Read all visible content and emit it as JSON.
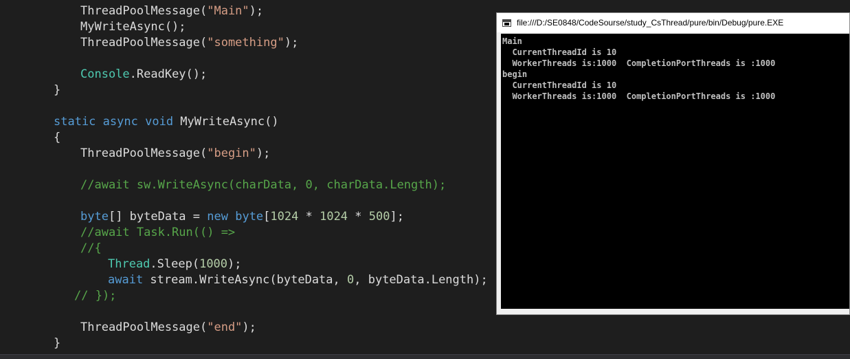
{
  "code_lines": [
    [
      {
        "t": "ThreadPoolMessage(",
        "c": "default"
      },
      {
        "t": "\"Main\"",
        "c": "string"
      },
      {
        "t": ");",
        "c": "default"
      }
    ],
    [
      {
        "t": "MyWriteAsync();",
        "c": "default"
      }
    ],
    [
      {
        "t": "ThreadPoolMessage(",
        "c": "default"
      },
      {
        "t": "\"something\"",
        "c": "string"
      },
      {
        "t": ");",
        "c": "default"
      }
    ],
    [],
    [
      {
        "t": "Console",
        "c": "type"
      },
      {
        "t": ".ReadKey();",
        "c": "default"
      }
    ],
    [
      {
        "t": "}",
        "c": "default"
      }
    ],
    [],
    [
      {
        "t": "static",
        "c": "keyword"
      },
      {
        "t": " ",
        "c": "default"
      },
      {
        "t": "async",
        "c": "keyword"
      },
      {
        "t": " ",
        "c": "default"
      },
      {
        "t": "void",
        "c": "keyword"
      },
      {
        "t": " MyWriteAsync()",
        "c": "default"
      }
    ],
    [
      {
        "t": "{",
        "c": "default"
      }
    ],
    [
      {
        "t": "ThreadPoolMessage(",
        "c": "default"
      },
      {
        "t": "\"begin\"",
        "c": "string"
      },
      {
        "t": ");",
        "c": "default"
      }
    ],
    [],
    [
      {
        "t": "//await sw.WriteAsync(charData, 0, charData.Length);",
        "c": "comment"
      }
    ],
    [],
    [
      {
        "t": "byte",
        "c": "keyword"
      },
      {
        "t": "[] byteData = ",
        "c": "default"
      },
      {
        "t": "new",
        "c": "keyword"
      },
      {
        "t": " ",
        "c": "default"
      },
      {
        "t": "byte",
        "c": "keyword"
      },
      {
        "t": "[",
        "c": "default"
      },
      {
        "t": "1024",
        "c": "number"
      },
      {
        "t": " * ",
        "c": "default"
      },
      {
        "t": "1024",
        "c": "number"
      },
      {
        "t": " * ",
        "c": "default"
      },
      {
        "t": "500",
        "c": "number"
      },
      {
        "t": "];",
        "c": "default"
      }
    ],
    [
      {
        "t": "//await Task.Run(() =>",
        "c": "comment"
      }
    ],
    [
      {
        "t": "//{",
        "c": "comment"
      }
    ],
    [
      {
        "t": "Thread",
        "c": "type"
      },
      {
        "t": ".Sleep(",
        "c": "default"
      },
      {
        "t": "1000",
        "c": "number"
      },
      {
        "t": ");",
        "c": "default"
      }
    ],
    [
      {
        "t": "await",
        "c": "keyword"
      },
      {
        "t": " stream.WriteAsync(byteData, ",
        "c": "default"
      },
      {
        "t": "0",
        "c": "number"
      },
      {
        "t": ", byteData.Length);",
        "c": "default"
      }
    ],
    [
      {
        "t": "// });",
        "c": "comment"
      }
    ],
    [],
    [
      {
        "t": "ThreadPoolMessage(",
        "c": "default"
      },
      {
        "t": "\"end\"",
        "c": "string"
      },
      {
        "t": ");",
        "c": "default"
      }
    ],
    [
      {
        "t": "}",
        "c": "default"
      }
    ]
  ],
  "console": {
    "title": "file:///D:/SE0848/CodeSourse/study_CsThread/pure/bin/Debug/pure.EXE",
    "lines": [
      "Main",
      "  CurrentThreadId is 10",
      "  WorkerThreads is:1000  CompletionPortThreads is :1000",
      "begin",
      "  CurrentThreadId is 10",
      "  WorkerThreads is:1000  CompletionPortThreads is :1000"
    ],
    "icon": "console-window-icon"
  },
  "colors": {
    "editor_background": "#1e1e1e",
    "string": "#d69d85",
    "keyword": "#569cd6",
    "type": "#4ec9b0",
    "comment": "#57a64a",
    "number": "#b5cea8",
    "console_background": "#000000",
    "console_text": "#c0c0c0"
  }
}
